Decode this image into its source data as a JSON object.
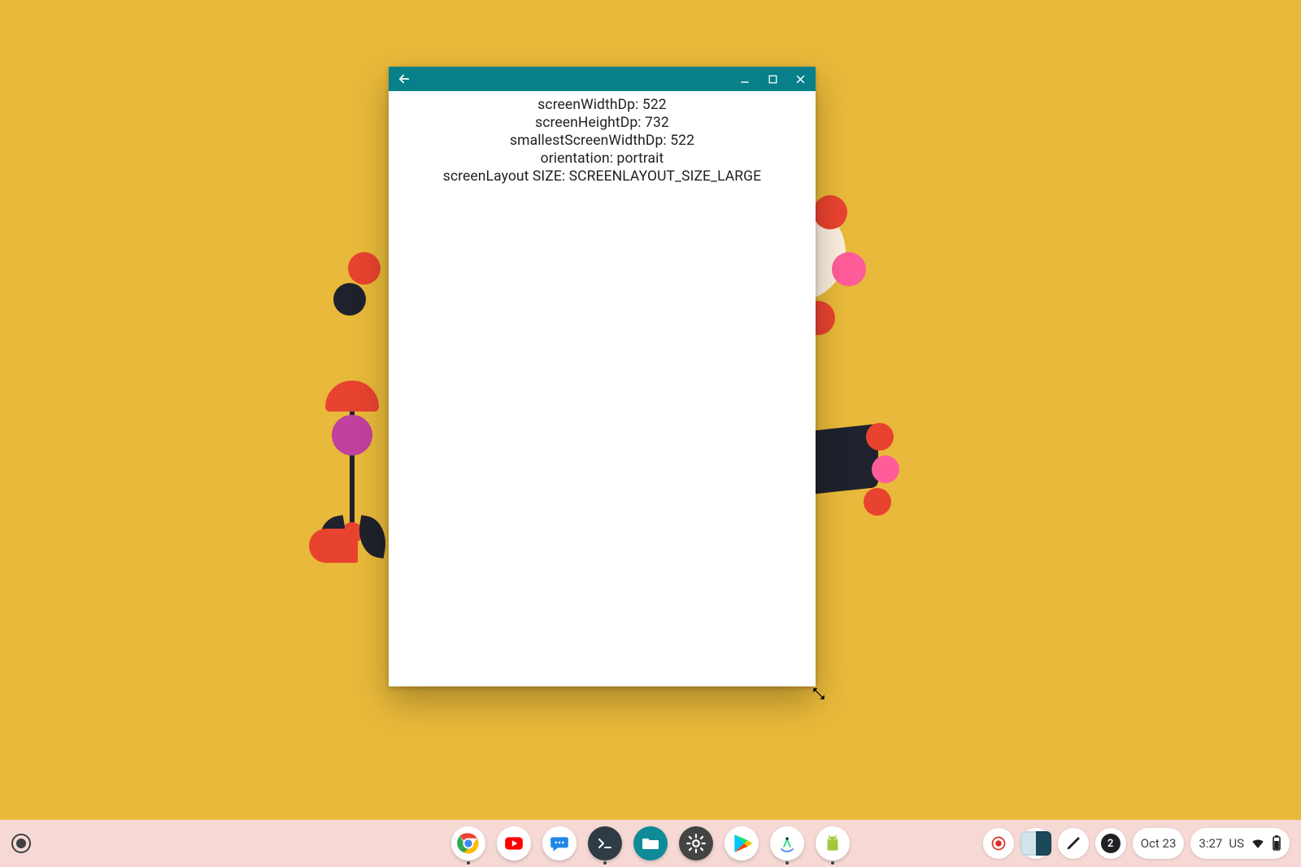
{
  "window": {
    "titlebar_color": "#07808a",
    "back_icon": "back",
    "min_icon": "minimize",
    "max_icon": "maximize",
    "close_icon": "close"
  },
  "config": {
    "screenWidthDp_label": "screenWidthDp: 522",
    "screenHeightDp_label": "screenHeightDp: 732",
    "smallestScreenWidthDp_label": "smallestScreenWidthDp: 522",
    "orientation_label": "orientation: portrait",
    "screenLayout_label": "screenLayout SIZE: SCREENLAYOUT_SIZE_LARGE"
  },
  "shelf": {
    "launcher": "launcher",
    "apps": [
      {
        "name": "chrome",
        "running": true
      },
      {
        "name": "youtube",
        "running": false
      },
      {
        "name": "messages",
        "running": false
      },
      {
        "name": "terminal",
        "running": true
      },
      {
        "name": "files",
        "running": false
      },
      {
        "name": "settings",
        "running": false
      },
      {
        "name": "play-store",
        "running": false
      },
      {
        "name": "android-studio",
        "running": true
      },
      {
        "name": "android-app",
        "running": true
      }
    ]
  },
  "tray": {
    "record_icon": "record",
    "overview_icon": "overview",
    "pen_icon": "stylus",
    "notification_count": "2",
    "date": "Oct 23",
    "time": "3:27",
    "locale": "US",
    "wifi_icon": "wifi",
    "battery_icon": "battery"
  }
}
